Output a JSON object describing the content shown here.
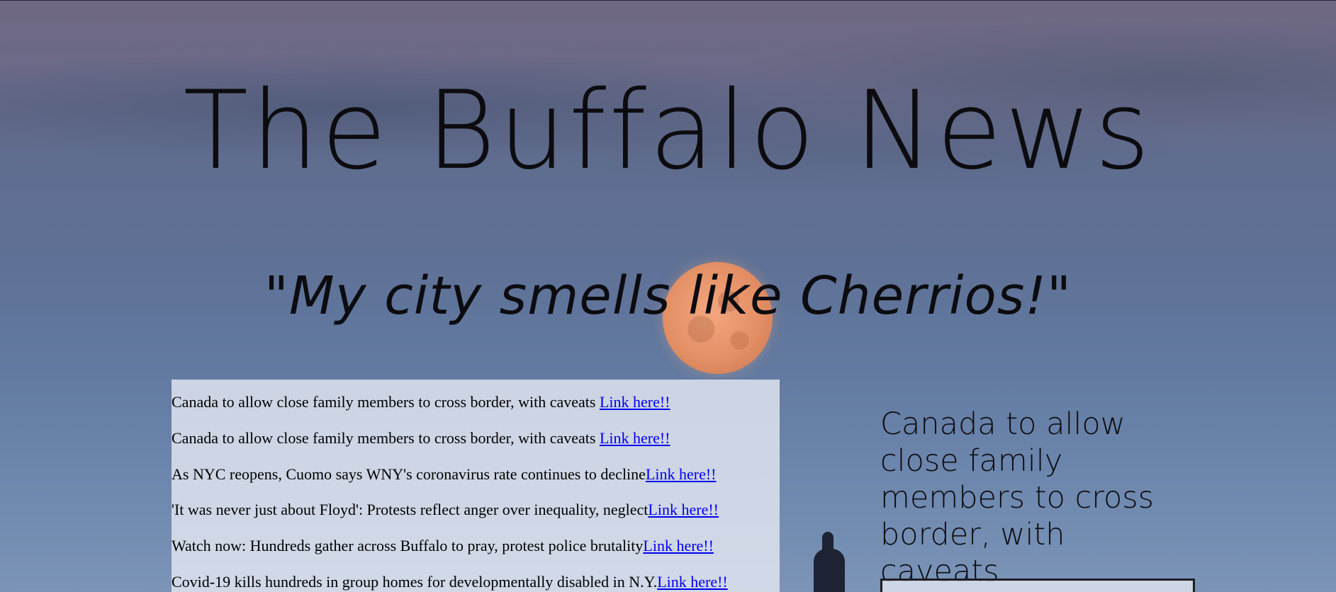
{
  "site": {
    "title": "The Buffalo News",
    "slogan": "\"My city smells like Cherrios!\""
  },
  "headlines": [
    {
      "text": "Canada to allow close family members to cross border, with caveats ",
      "link": "Link here!!"
    },
    {
      "text": "Canada to allow close family members to cross border, with caveats ",
      "link": "Link here!!"
    },
    {
      "text": "As NYC reopens, Cuomo says WNY's coronavirus rate continues to decline",
      "link": "Link here!!"
    },
    {
      "text": "'It was never just about Floyd': Protests reflect anger over inequality, neglect",
      "link": "Link here!!"
    },
    {
      "text": "Watch now: Hundreds gather across Buffalo to pray, protest police brutality",
      "link": "Link here!!"
    },
    {
      "text": "Covid-19 kills hundreds in group homes for developmentally disabled in N.Y.",
      "link": "Link here!!"
    }
  ],
  "feature": {
    "title": "Canada to allow close family members to cross border, with caveats"
  }
}
